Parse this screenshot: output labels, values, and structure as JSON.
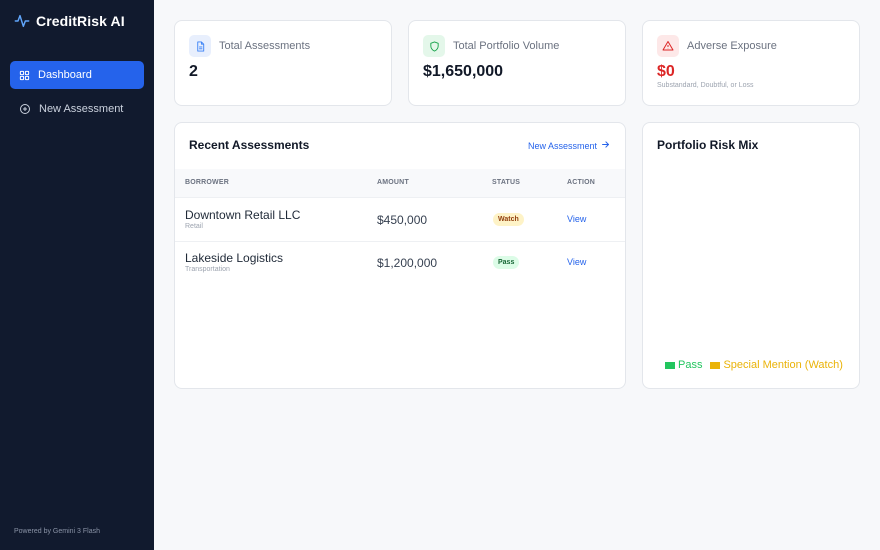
{
  "app": {
    "name": "CreditRisk AI",
    "powered_by": "Powered by Gemini 3 Flash"
  },
  "sidebar": {
    "items": [
      {
        "label": "Dashboard",
        "icon": "grid-icon",
        "active": true
      },
      {
        "label": "New Assessment",
        "icon": "plus-circle-icon",
        "active": false
      }
    ]
  },
  "stats": {
    "total_assessments": {
      "title": "Total Assessments",
      "value": "2",
      "icon": "document-icon",
      "color": "#3b82f6"
    },
    "portfolio_volume": {
      "title": "Total Portfolio Volume",
      "value": "$1,650,000",
      "icon": "shield-icon",
      "color": "#16a34a"
    },
    "adverse_exposure": {
      "title": "Adverse Exposure",
      "value": "$0",
      "subtitle": "Substandard, Doubtful, or Loss",
      "icon": "warning-icon",
      "color": "#dc2626"
    }
  },
  "recent": {
    "title": "Recent Assessments",
    "new_link": "New Assessment",
    "columns": {
      "borrower": "BORROWER",
      "amount": "AMOUNT",
      "status": "STATUS",
      "action": "ACTION"
    },
    "rows": [
      {
        "name": "Downtown Retail LLC",
        "sector": "Retail",
        "amount": "$450,000",
        "status": "Watch",
        "action": "View"
      },
      {
        "name": "Lakeside Logistics",
        "sector": "Transportation",
        "amount": "$1,200,000",
        "status": "Pass",
        "action": "View"
      }
    ]
  },
  "risk_mix": {
    "title": "Portfolio Risk Mix",
    "legend": [
      {
        "label": "Pass",
        "color": "#22c55e"
      },
      {
        "label": "Special Mention (Watch)",
        "color": "#eab308"
      }
    ]
  },
  "colors": {
    "sidebar_bg": "#111a2e",
    "accent": "#2563eb",
    "danger": "#dc2626",
    "success": "#22c55e",
    "warning": "#eab308"
  }
}
